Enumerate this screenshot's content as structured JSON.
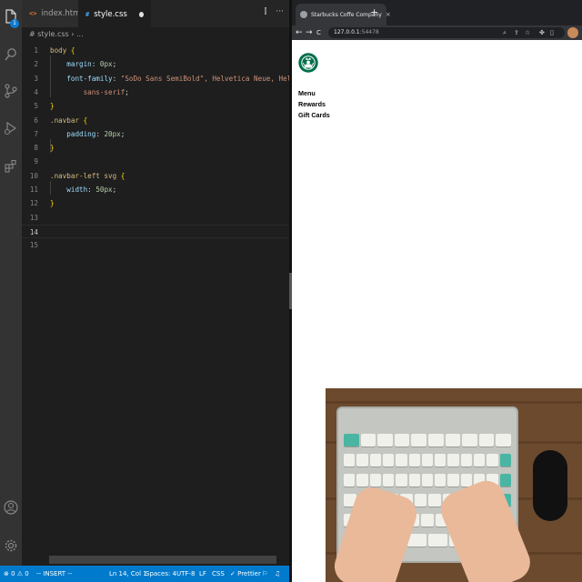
{
  "vscode": {
    "activity_bar": {
      "files_badge": "1"
    },
    "tabs": [
      {
        "label": "index.html",
        "icon": "<>",
        "active": false
      },
      {
        "label": "style.css",
        "icon": "#",
        "active": true,
        "dirty": true
      }
    ],
    "editor_actions": {
      "split": "⫿",
      "more": "···"
    },
    "breadcrumb": "# style.css › ...",
    "code_lines": [
      {
        "n": "1",
        "text": "body {"
      },
      {
        "n": "2",
        "text": "    margin: 0px;"
      },
      {
        "n": "3",
        "text": "    font-family: \"SoDo Sans SemiBold\", Helvetica Neue, Helvetica, Arial,"
      },
      {
        "n": "4",
        "text": "        sans-serif;"
      },
      {
        "n": "5",
        "text": "}"
      },
      {
        "n": "6",
        "text": ".navbar {"
      },
      {
        "n": "7",
        "text": "    padding: 20px;"
      },
      {
        "n": "8",
        "text": "}"
      },
      {
        "n": "9",
        "text": ""
      },
      {
        "n": "10",
        "text": ".navbar-left svg {"
      },
      {
        "n": "11",
        "text": "    width: 50px;"
      },
      {
        "n": "12",
        "text": "}"
      },
      {
        "n": "13",
        "text": ""
      },
      {
        "n": "14",
        "text": ""
      },
      {
        "n": "15",
        "text": ""
      }
    ],
    "current_line": "14",
    "status_bar": {
      "problems": "⊗ 0 ⚠ 0",
      "mode": "-- INSERT --",
      "position": "Ln 14, Col 1",
      "spaces": "Spaces: 4",
      "encoding": "UTF-8",
      "eol": "LF",
      "language": "CSS",
      "formatter": "✓ Prettier"
    }
  },
  "browser": {
    "tab_title": "Starbucks Coffe Company",
    "tab_close": "×",
    "new_tab": "+",
    "url_host": "127.0.0.1",
    "url_port": ":54478",
    "nav": {
      "back": "←",
      "forward": "→",
      "reload": "C"
    },
    "page": {
      "logo": "starbucks-siren-logo",
      "links": [
        "Menu",
        "Rewards",
        "Gift Cards"
      ]
    }
  },
  "colors": {
    "vscode_bg": "#1e1e1e",
    "status_bar": "#007acc",
    "starbucks_green": "#00704a"
  }
}
